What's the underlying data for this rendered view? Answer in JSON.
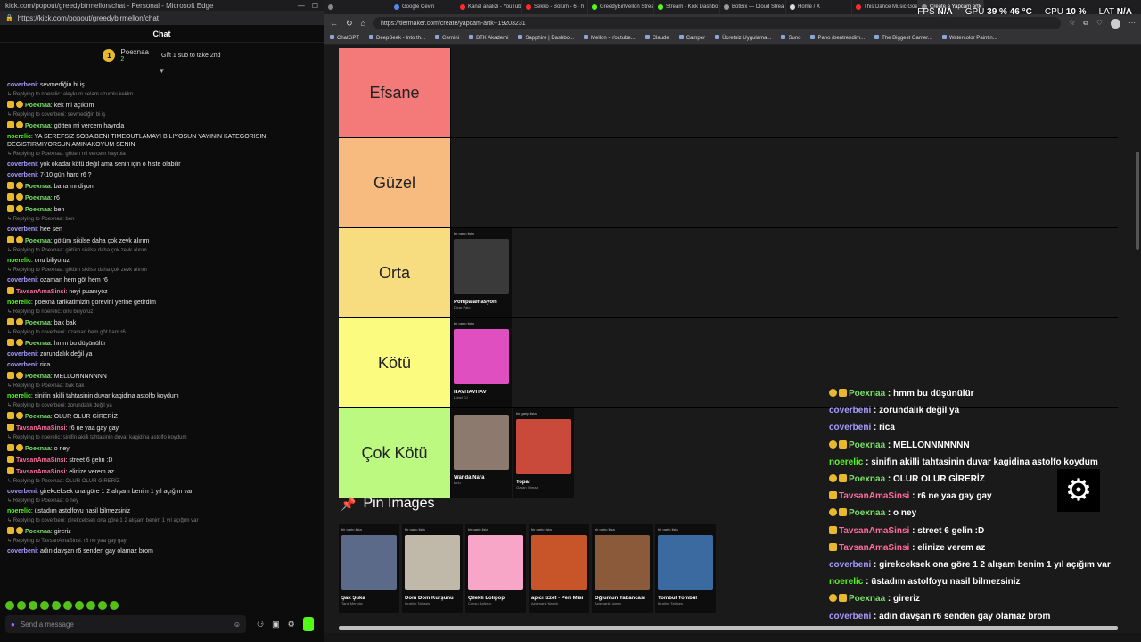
{
  "left_window": {
    "title": "kick.com/popout/greedybirmellon/chat - Personal - Microsoft Edge",
    "url": "https://kick.com/popout/greedybirmellon/chat",
    "chat_title": "Chat",
    "pinned": {
      "number": "1",
      "name": "Poexnaa",
      "count": "2",
      "gift_text": "Gift 1 sub to take 2nd"
    },
    "input_placeholder": "Send a message",
    "messages": [
      {
        "reply": "",
        "user": "coverbeni",
        "color": "#a89bff",
        "badges": [],
        "text": "sevmediğin bi iş"
      },
      {
        "reply": "Replying to noerelic: aleykum selam uzumlu keklm",
        "user": "Poexnaa",
        "color": "#7adf6a",
        "badges": [
          "crown",
          "one"
        ],
        "text": "kek mi açıktım"
      },
      {
        "reply": "Replying to coverbeni: sevmediğin bi iş",
        "user": "Poexnaa",
        "color": "#7adf6a",
        "badges": [
          "crown",
          "one"
        ],
        "text": "götten mi vercem hayrola"
      },
      {
        "reply": "",
        "user": "noerelic",
        "color": "#53fc18",
        "badges": [],
        "text": "YA SEREFSIZ SOBA BENI TIMEOUTLAMAYI BILIYOSUN YAYININ KATEGORISINI DEGISTIRMIYORSUN AMINAKOYUM SENIN"
      },
      {
        "reply": "Replying to Poexnaa: götten mi vercem hayrola",
        "user": "coverbeni",
        "color": "#a89bff",
        "badges": [],
        "text": "yok okadar kötü değil ama senin için o histe olabilir"
      },
      {
        "reply": "",
        "user": "coverbeni",
        "color": "#a89bff",
        "badges": [],
        "text": "7-10 gün hard r6 ?"
      },
      {
        "reply": "",
        "user": "Poexnaa",
        "color": "#7adf6a",
        "badges": [
          "crown",
          "one"
        ],
        "text": "bana mı diyon"
      },
      {
        "reply": "",
        "user": "Poexnaa",
        "color": "#7adf6a",
        "badges": [
          "crown",
          "one"
        ],
        "text": "r6"
      },
      {
        "reply": "",
        "user": "Poexnaa",
        "color": "#7adf6a",
        "badges": [
          "crown",
          "one"
        ],
        "text": "ben"
      },
      {
        "reply": "Replying to Poexnaa: ben",
        "user": "coverbeni",
        "color": "#a89bff",
        "badges": [],
        "text": "hee sen"
      },
      {
        "reply": "",
        "user": "Poexnaa",
        "color": "#7adf6a",
        "badges": [
          "crown",
          "one"
        ],
        "text": "götüm sikilse daha çok zevk alırım"
      },
      {
        "reply": "Replying to Poexnaa: götüm sikilse daha çok zevk alırım",
        "user": "noerelic",
        "color": "#53fc18",
        "badges": [],
        "text": "onu biliyoruz"
      },
      {
        "reply": "Replying to Poexnaa: götüm sikilse daha çok zevk alırım",
        "user": "coverbeni",
        "color": "#a89bff",
        "badges": [],
        "text": "ozaman hem göt hem r6"
      },
      {
        "reply": "",
        "user": "TavsanAmaSinsi",
        "color": "#ff6b9a",
        "badges": [
          "crown"
        ],
        "text": "neyi puanıyoz"
      },
      {
        "reply": "",
        "user": "noerelic",
        "color": "#53fc18",
        "badges": [],
        "text": "poexna tarikatimizin gorevini yerine getirdim"
      },
      {
        "reply": "Replying to noerelic: onu biliyoruz",
        "user": "Poexnaa",
        "color": "#7adf6a",
        "badges": [
          "crown",
          "one"
        ],
        "text": "bak bak"
      },
      {
        "reply": "Replying to coverbeni: ozaman hem göt ham r6",
        "user": "Poexnaa",
        "color": "#7adf6a",
        "badges": [
          "crown",
          "one"
        ],
        "text": "hmm bu düşünülür"
      },
      {
        "reply": "",
        "user": "coverbeni",
        "color": "#a89bff",
        "badges": [],
        "text": "zorundalık değil ya"
      },
      {
        "reply": "",
        "user": "coverbeni",
        "color": "#a89bff",
        "badges": [],
        "text": "rica"
      },
      {
        "reply": "",
        "user": "Poexnaa",
        "color": "#7adf6a",
        "badges": [
          "crown",
          "one"
        ],
        "text": "MELLONNNNNNN"
      },
      {
        "reply": "Replying to Poexnaa: bak bak",
        "user": "noerelic",
        "color": "#53fc18",
        "badges": [],
        "text": "sinifin akilli tahtasinin duvar kagidina astolfo koydum"
      },
      {
        "reply": "Replying to coverbeni: zorundalık değil ya",
        "user": "Poexnaa",
        "color": "#7adf6a",
        "badges": [
          "crown",
          "one"
        ],
        "text": "OLUR OLUR GİRERİZ"
      },
      {
        "reply": "",
        "user": "TavsanAmaSinsi",
        "color": "#ff6b9a",
        "badges": [
          "crown"
        ],
        "text": "r6 ne yaa gay gay"
      },
      {
        "reply": "Replying to noerelic: sinifin akilli tahtasinin duvar kagidina astolfo koydum",
        "user": "Poexnaa",
        "color": "#7adf6a",
        "badges": [
          "crown",
          "one"
        ],
        "text": "o ney"
      },
      {
        "reply": "",
        "user": "TavsanAmaSinsi",
        "color": "#ff6b9a",
        "badges": [
          "crown"
        ],
        "text": "street 6 gelin :D"
      },
      {
        "reply": "",
        "user": "TavsanAmaSinsi",
        "color": "#ff6b9a",
        "badges": [
          "crown"
        ],
        "text": "elinize verem az"
      },
      {
        "reply": "Replying to Poexnaa: OLUR OLUR GİRERİZ",
        "user": "coverbeni",
        "color": "#a89bff",
        "badges": [],
        "text": "girekceksek ona göre 1 2 alışam benim 1 yıl açığım var"
      },
      {
        "reply": "Replying to Poexnaa: o ney",
        "user": "noerelic",
        "color": "#53fc18",
        "badges": [],
        "text": "üstadım astolfoyu nasil bilmezsiniz"
      },
      {
        "reply": "Replying to coverbeni: girekceksek ona göre 1 2 alışam benim 1 yıl açığım var",
        "user": "Poexnaa",
        "color": "#7adf6a",
        "badges": [
          "crown",
          "one"
        ],
        "text": "gireriz"
      },
      {
        "reply": "Replying to TavsanAmaSinsi: r6 ne yaa gay gay",
        "user": "coverbeni",
        "color": "#a89bff",
        "badges": [],
        "text": "adın davşan r6 senden gay olamaz brom"
      }
    ]
  },
  "browser": {
    "tabs": [
      {
        "label": "",
        "color": "#888888",
        "active": false
      },
      {
        "label": "Google Çeviri",
        "color": "#4c8bf5",
        "active": false
      },
      {
        "label": "Kanal analizi - YouTub",
        "color": "#ff2b2b",
        "active": false
      },
      {
        "label": "Sekko - Bölüm - 6 - h",
        "color": "#ff2b2b",
        "active": false
      },
      {
        "label": "GreedyBirMellon Strea",
        "color": "#53fc18",
        "active": false
      },
      {
        "label": "Stream - Kick Dashbo",
        "color": "#53fc18",
        "active": false
      },
      {
        "label": "BotBix — Cloud Strea",
        "color": "#9a9a9a",
        "active": false
      },
      {
        "label": "Home / X",
        "color": "#dddddd",
        "active": false
      },
      {
        "label": "This Dance Music Goe",
        "color": "#ff2b2b",
        "active": false
      },
      {
        "label": "Create a Yapcam artk",
        "color": "#9a9a9a",
        "active": true
      }
    ],
    "url": "https://tiermaker.com/create/yapcam-artk--19203231",
    "bookmarks": [
      "ChatGPT",
      "DeepSeek - Into th...",
      "Gemini",
      "BTK Akademi",
      "Sapphire | Dashbo...",
      "Mellon - Youtube...",
      "Claude",
      "Camper",
      "Ücretsiz Uygulama...",
      "Suno",
      "Pano (bentrendim...",
      "The Biggest Gamer...",
      "Watercolor Paintin..."
    ]
  },
  "perf": {
    "fps_label": "FPS",
    "fps": "N/A",
    "gpu_label": "GPU",
    "gpu": "39 % 46 °C",
    "cpu_label": "CPU",
    "cpu": "10 %",
    "lat_label": "LAT",
    "lat": "N/A"
  },
  "tiers": [
    {
      "label": "Efsane",
      "color": "#f47a7a",
      "items": []
    },
    {
      "label": "Güzel",
      "color": "#f7bb7f",
      "items": []
    },
    {
      "label": "Orta",
      "color": "#f7dd7f",
      "items": [
        {
          "tag": "bir garip lista",
          "title": "Pompalamasyon",
          "sub": "Diyar Palo",
          "art": "#3a3a3a"
        }
      ]
    },
    {
      "label": "Kötü",
      "color": "#fbfb80",
      "items": [
        {
          "tag": "bir garip lista",
          "title": "HAVHAVHAV",
          "sub": "Lobst DJ",
          "art": "#e04fbf"
        }
      ]
    },
    {
      "label": "Çok Kötü",
      "color": "#bbf981",
      "items": [
        {
          "tag": "",
          "title": "Wanda Nara",
          "sub": "tarlu",
          "art": "#8c7a6f"
        },
        {
          "tag": "bir garip lista",
          "title": "Topal",
          "sub": "Ozkan Yilmaz",
          "art": "#c94a3a"
        }
      ]
    }
  ],
  "pin_title": "Pin Images",
  "pin_images": [
    {
      "tag": "bir garip lista",
      "title": "Şak Şuka",
      "sub": "Tarık Mengüç",
      "art": "#5b6a88"
    },
    {
      "tag": "bir garip lista",
      "title": "Dom Dom Kurşunu",
      "sub": "İbrahim Tatlıses",
      "art": "#c0b9a9"
    },
    {
      "tag": "bir garip lista",
      "title": "Çilekli Lolipop",
      "sub": "Cansu Bağırıcı",
      "art": "#f7a6c8"
    },
    {
      "tag": "bir garip lista",
      "title": "apıcı İzzet - Peri Misi",
      "sub": "Azizmarık Namık",
      "art": "#c8542a"
    },
    {
      "tag": "bir garip lista",
      "title": "Oğlumun Tabancası",
      "sub": "Azizmarık Namık",
      "art": "#8a5a3a"
    },
    {
      "tag": "bir garip lista",
      "title": "Tombul Tombul",
      "sub": "İbrahim Tatlıses",
      "art": "#3a6aa0"
    }
  ],
  "overlay_chat": [
    {
      "user": "Poexnaa",
      "color": "#7adf6a",
      "badges": [
        "one",
        "crown"
      ],
      "text": "hmm bu düşünülür"
    },
    {
      "user": "coverbeni",
      "color": "#a89bff",
      "badges": [],
      "text": "zorundalık değil ya"
    },
    {
      "user": "coverbeni",
      "color": "#a89bff",
      "badges": [],
      "text": "rica"
    },
    {
      "user": "Poexnaa",
      "color": "#7adf6a",
      "badges": [
        "one",
        "crown"
      ],
      "text": "MELLONNNNNNN"
    },
    {
      "user": "noerelic",
      "color": "#53fc18",
      "badges": [],
      "text": "sinifin akilli tahtasinin duvar kagidina astolfo koydum"
    },
    {
      "user": "Poexnaa",
      "color": "#7adf6a",
      "badges": [
        "one",
        "crown"
      ],
      "text": "OLUR OLUR GİRERİZ"
    },
    {
      "user": "TavsanAmaSinsi",
      "color": "#ff6b9a",
      "badges": [
        "crown"
      ],
      "text": "r6 ne yaa gay gay"
    },
    {
      "user": "Poexnaa",
      "color": "#7adf6a",
      "badges": [
        "one",
        "crown"
      ],
      "text": "o ney"
    },
    {
      "user": "TavsanAmaSinsi",
      "color": "#ff6b9a",
      "badges": [
        "crown"
      ],
      "text": "street 6 gelin :D"
    },
    {
      "user": "TavsanAmaSinsi",
      "color": "#ff6b9a",
      "badges": [
        "crown"
      ],
      "text": "elinize verem az"
    },
    {
      "user": "coverbeni",
      "color": "#a89bff",
      "badges": [],
      "text": "girekceksek ona göre 1 2 alışam benim 1 yıl açığım var"
    },
    {
      "user": "noerelic",
      "color": "#53fc18",
      "badges": [],
      "text": "üstadım astolfoyu nasil bilmezsiniz"
    },
    {
      "user": "Poexnaa",
      "color": "#7adf6a",
      "badges": [
        "one",
        "crown"
      ],
      "text": "gireriz"
    },
    {
      "user": "coverbeni",
      "color": "#a89bff",
      "badges": [],
      "text": "adın davşan r6 senden gay olamaz brom"
    }
  ]
}
